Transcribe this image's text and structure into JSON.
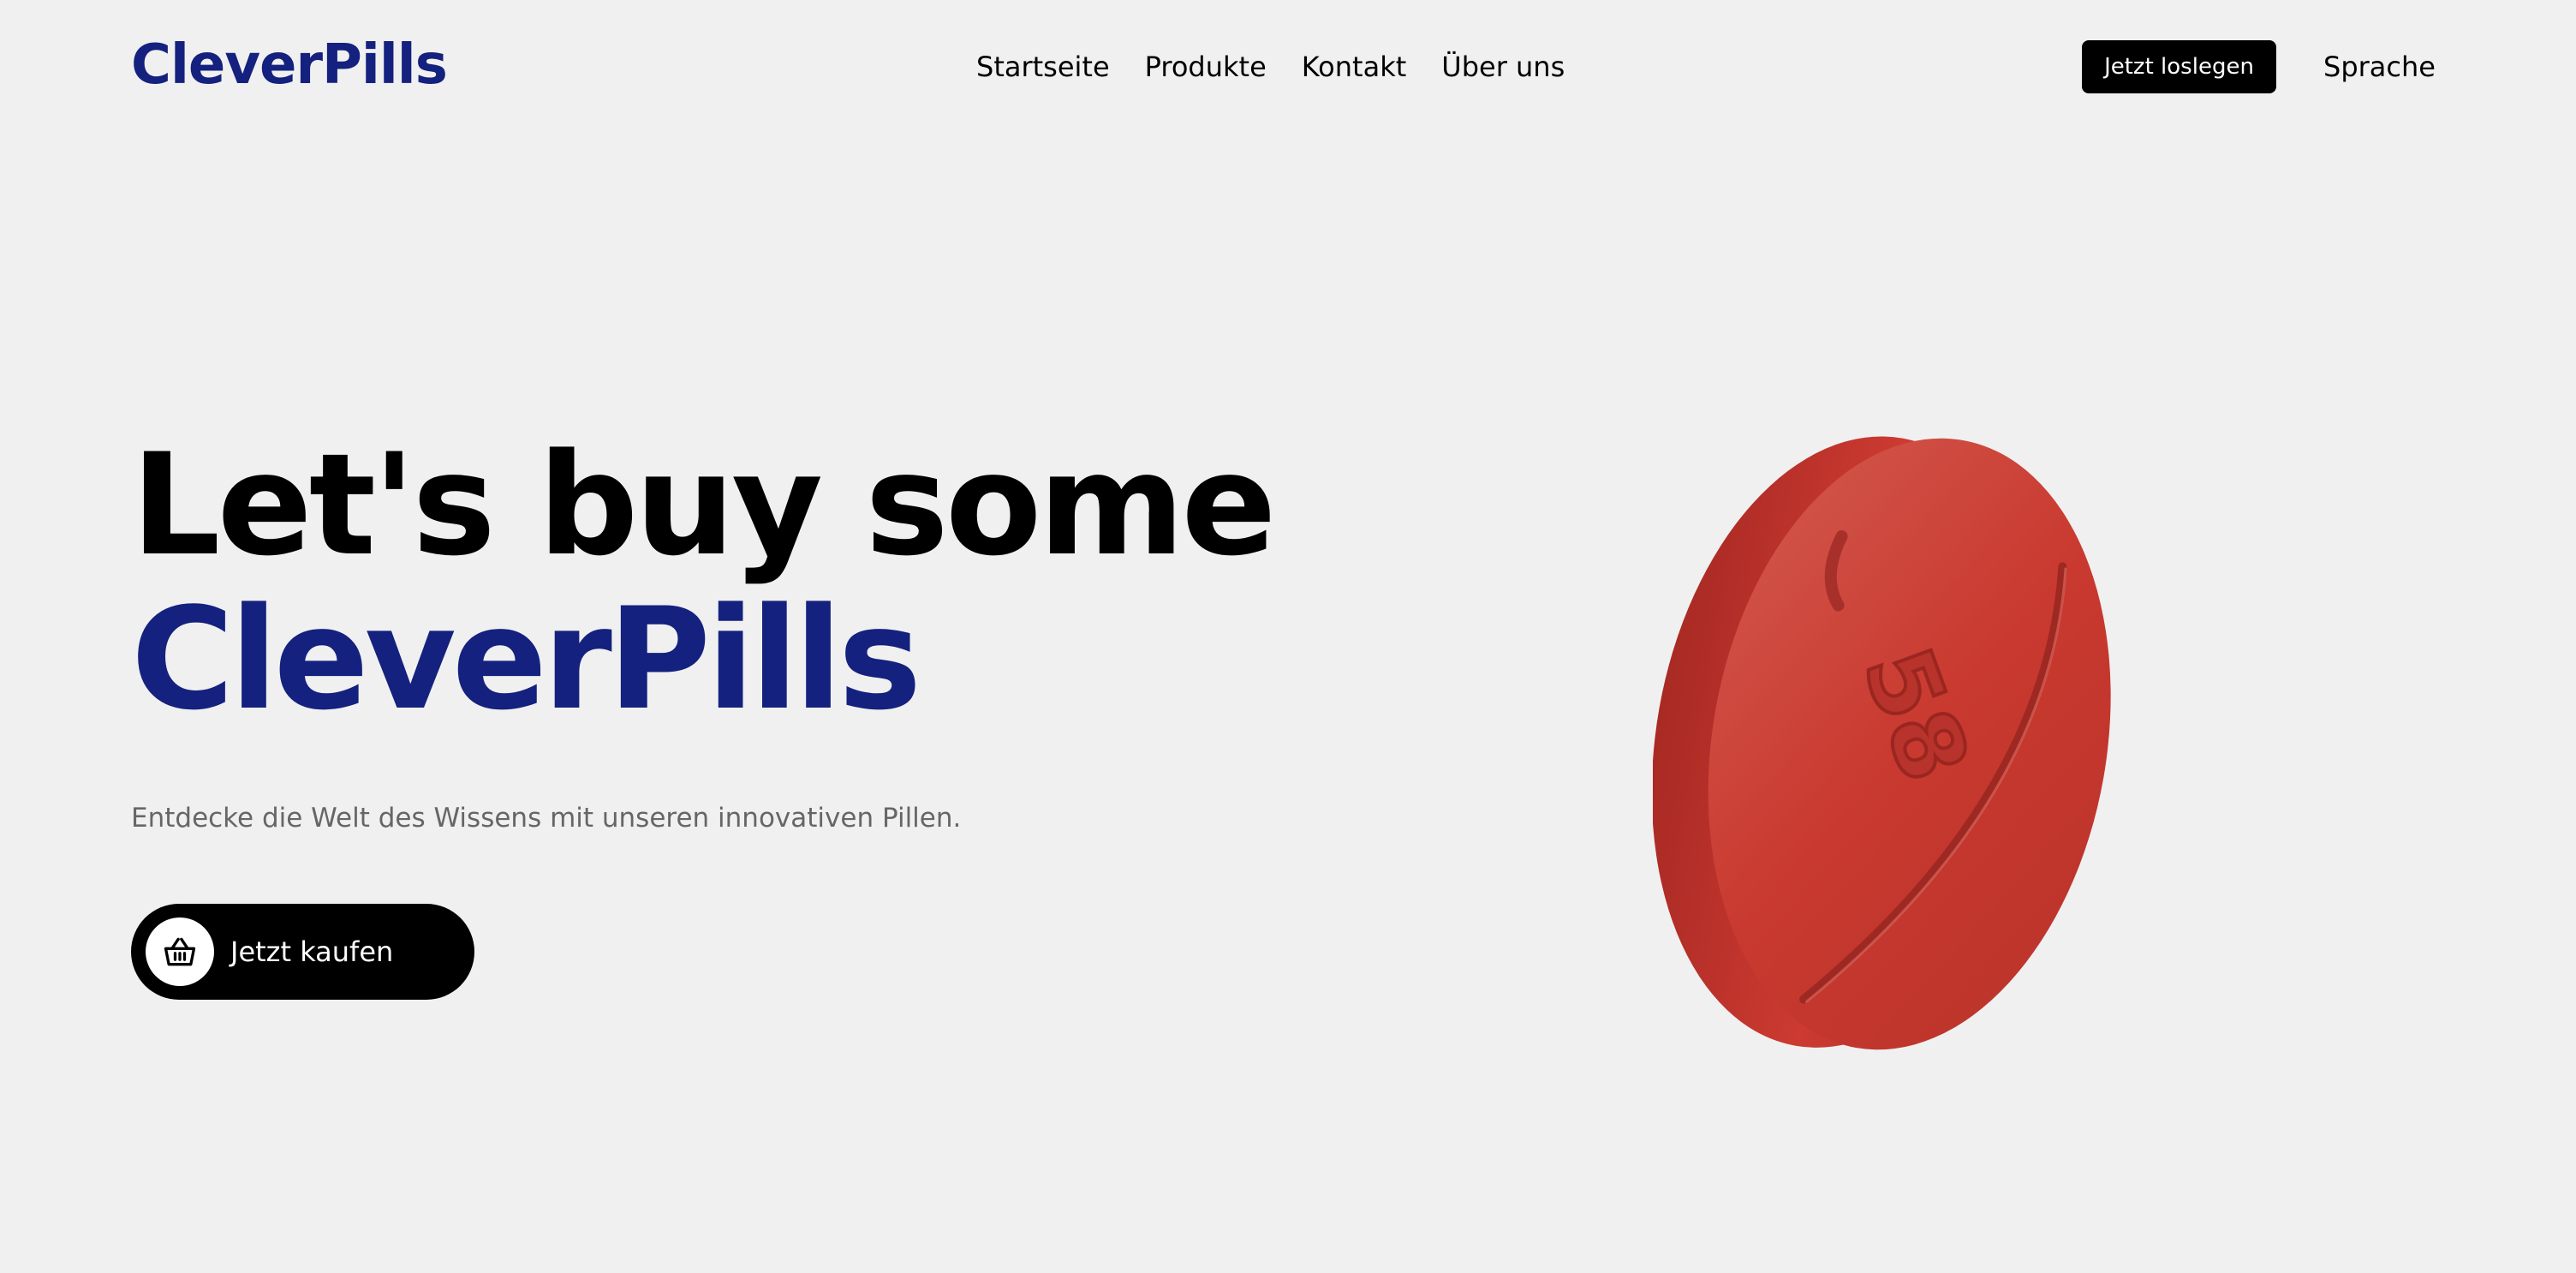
{
  "brand": {
    "logo": "CleverPills",
    "color": "#14217e"
  },
  "nav": {
    "links": [
      "Startseite",
      "Produkte",
      "Kontakt",
      "Über uns"
    ],
    "cta": "Jetzt loslegen",
    "language": "Sprache"
  },
  "hero": {
    "line1": "Let's buy some",
    "line2": "CleverPills",
    "subtitle": "Entdecke die Welt des Wissens mit unseren innovativen Pillen.",
    "button": {
      "label": "Jetzt kaufen",
      "icon": "basket-icon"
    }
  },
  "image": {
    "name": "red-pill-image",
    "imprint": "58",
    "color": "#c8342c"
  }
}
